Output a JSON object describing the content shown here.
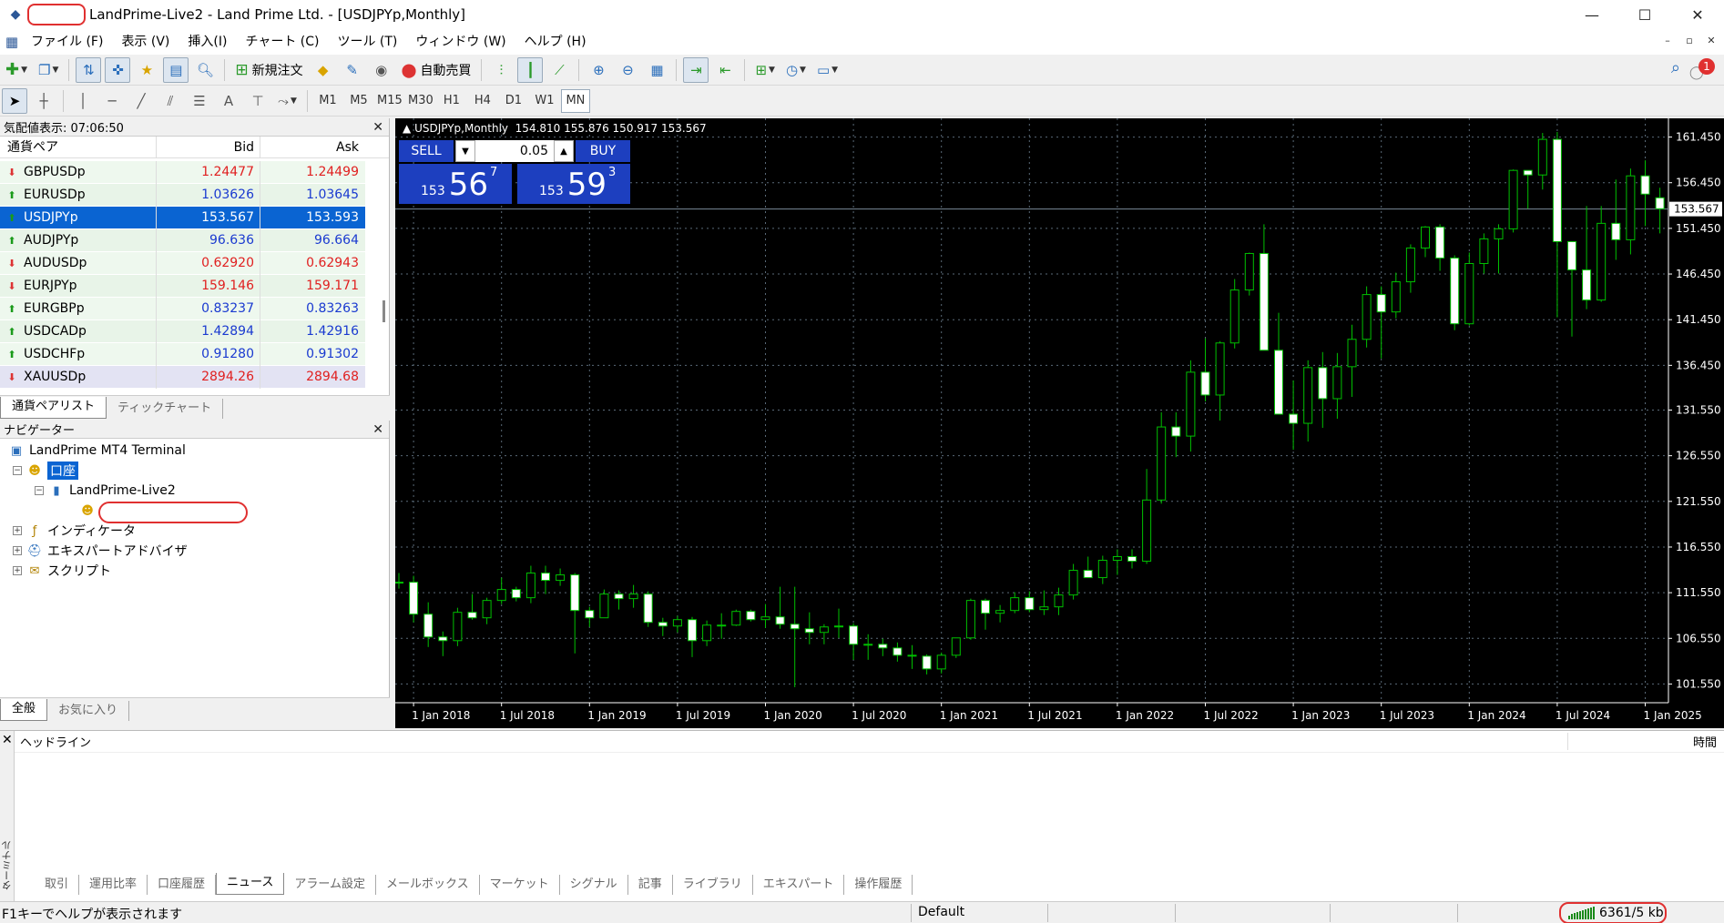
{
  "window": {
    "title": "LandPrime-Live2 - Land Prime Ltd. - [USDJPYp,Monthly]",
    "minimize": "—",
    "maximize": "☐",
    "close": "✕"
  },
  "menu": [
    "ファイル (F)",
    "表示 (V)",
    "挿入(I)",
    "チャート (C)",
    "ツール (T)",
    "ウィンドウ (W)",
    "ヘルプ (H)"
  ],
  "toolbar": {
    "new_order_label": "新規注文",
    "auto_trading_label": "自動売買",
    "notification_count": "1"
  },
  "timeframes": [
    "M1",
    "M5",
    "M15",
    "M30",
    "H1",
    "H4",
    "D1",
    "W1",
    "MN"
  ],
  "active_timeframe": "MN",
  "market_watch": {
    "title": "気配値表示: 07:06:50",
    "col_symbol": "通貨ペア",
    "col_bid": "Bid",
    "col_ask": "Ask",
    "rows": [
      {
        "symbol": "GBPUSDp",
        "bid": "1.24477",
        "ask": "1.24499",
        "dir": "down"
      },
      {
        "symbol": "EURUSDp",
        "bid": "1.03626",
        "ask": "1.03645",
        "dir": "up"
      },
      {
        "symbol": "USDJPYp",
        "bid": "153.567",
        "ask": "153.593",
        "dir": "up"
      },
      {
        "symbol": "AUDJPYp",
        "bid": "96.636",
        "ask": "96.664",
        "dir": "up"
      },
      {
        "symbol": "AUDUSDp",
        "bid": "0.62920",
        "ask": "0.62943",
        "dir": "down"
      },
      {
        "symbol": "EURJPYp",
        "bid": "159.146",
        "ask": "159.171",
        "dir": "down"
      },
      {
        "symbol": "EURGBPp",
        "bid": "0.83237",
        "ask": "0.83263",
        "dir": "up"
      },
      {
        "symbol": "USDCADp",
        "bid": "1.42894",
        "ask": "1.42916",
        "dir": "up"
      },
      {
        "symbol": "USDCHFp",
        "bid": "0.91280",
        "ask": "0.91302",
        "dir": "up"
      },
      {
        "symbol": "XAUUSDp",
        "bid": "2894.26",
        "ask": "2894.68",
        "dir": "down"
      }
    ],
    "tabs": [
      "通貨ペアリスト",
      "ティックチャート"
    ],
    "up_color": "#1a3ad0",
    "down_color": "#e02020"
  },
  "navigator": {
    "title": "ナビゲーター",
    "root": "LandPrime MT4 Terminal",
    "accounts": "口座",
    "server": "LandPrime-Live2",
    "indicators": "インディケータ",
    "experts": "エキスパートアドバイザ",
    "scripts": "スクリプト",
    "tabs": [
      "全般",
      "お気に入り"
    ]
  },
  "chart_data": {
    "type": "candlestick",
    "symbol_header": "USDJPYp,Monthly",
    "ohlc_header": "154.810 155.876 150.917 153.567",
    "current_price": "153.567",
    "current_price_value": 153.567,
    "ylim": [
      99.5,
      163.5
    ],
    "y_ticks": [
      "161.450",
      "156.450",
      "151.450",
      "146.450",
      "141.450",
      "136.450",
      "131.550",
      "126.550",
      "121.550",
      "116.550",
      "111.550",
      "106.550",
      "101.550"
    ],
    "y_tick_values": [
      161.45,
      156.45,
      151.45,
      146.45,
      141.45,
      136.45,
      131.55,
      126.55,
      121.55,
      116.55,
      111.55,
      106.55,
      101.55
    ],
    "x_ticks": [
      "1 Jan 2018",
      "1 Jul 2018",
      "1 Jan 2019",
      "1 Jul 2019",
      "1 Jan 2020",
      "1 Jul 2020",
      "1 Jan 2021",
      "1 Jul 2021",
      "1 Jan 2022",
      "1 Jul 2022",
      "1 Jan 2023",
      "1 Jul 2023",
      "1 Jan 2024",
      "1 Jul 2024",
      "1 Jan 2025"
    ],
    "start_month": "2017-12",
    "x_tick_indices": [
      1,
      7,
      13,
      19,
      25,
      31,
      37,
      43,
      49,
      55,
      61,
      67,
      73,
      79,
      85
    ],
    "candles": [
      [
        112.6,
        113.7,
        112.0,
        112.7
      ],
      [
        112.7,
        113.4,
        108.3,
        109.2
      ],
      [
        109.2,
        110.5,
        105.6,
        106.7
      ],
      [
        106.7,
        107.3,
        104.6,
        106.3
      ],
      [
        106.3,
        109.9,
        105.7,
        109.4
      ],
      [
        109.4,
        111.4,
        108.6,
        108.8
      ],
      [
        108.8,
        111.0,
        108.1,
        110.7
      ],
      [
        110.7,
        113.2,
        110.3,
        111.9
      ],
      [
        111.9,
        112.2,
        110.6,
        111.0
      ],
      [
        111.0,
        114.5,
        110.4,
        113.7
      ],
      [
        113.7,
        114.5,
        111.4,
        112.9
      ],
      [
        112.9,
        114.2,
        112.3,
        113.5
      ],
      [
        113.5,
        113.7,
        104.9,
        109.6
      ],
      [
        109.6,
        110.0,
        107.8,
        108.8
      ],
      [
        108.8,
        111.9,
        108.8,
        111.4
      ],
      [
        111.4,
        111.8,
        109.7,
        110.9
      ],
      [
        110.9,
        112.4,
        109.9,
        111.4
      ],
      [
        111.4,
        111.7,
        107.8,
        108.3
      ],
      [
        108.3,
        108.8,
        106.8,
        107.9
      ],
      [
        107.9,
        109.0,
        107.2,
        108.6
      ],
      [
        108.6,
        108.9,
        104.5,
        106.3
      ],
      [
        106.3,
        108.5,
        105.7,
        108.0
      ],
      [
        108.0,
        109.3,
        106.5,
        108.0
      ],
      [
        108.0,
        109.7,
        107.9,
        109.5
      ],
      [
        109.5,
        109.7,
        108.4,
        108.6
      ],
      [
        108.6,
        110.3,
        107.7,
        108.9
      ],
      [
        108.9,
        112.2,
        107.6,
        108.1
      ],
      [
        108.1,
        112.2,
        101.2,
        107.6
      ],
      [
        107.6,
        109.4,
        105.9,
        107.2
      ],
      [
        107.2,
        108.1,
        105.9,
        107.8
      ],
      [
        107.8,
        109.8,
        106.6,
        107.9
      ],
      [
        107.9,
        108.2,
        104.2,
        105.9
      ],
      [
        105.9,
        107.0,
        104.2,
        105.9
      ],
      [
        105.9,
        106.5,
        104.6,
        105.5
      ],
      [
        105.5,
        106.1,
        104.0,
        104.7
      ],
      [
        104.7,
        105.8,
        103.2,
        104.6
      ],
      [
        104.6,
        104.8,
        102.6,
        103.2
      ],
      [
        103.2,
        105.0,
        102.7,
        104.7
      ],
      [
        104.7,
        106.2,
        104.4,
        106.6
      ],
      [
        106.6,
        110.9,
        106.4,
        110.7
      ],
      [
        110.7,
        110.9,
        107.5,
        109.3
      ],
      [
        109.3,
        110.2,
        108.3,
        109.6
      ],
      [
        109.6,
        111.6,
        109.3,
        111.0
      ],
      [
        111.0,
        111.7,
        109.4,
        109.7
      ],
      [
        109.7,
        111.8,
        109.1,
        110.0
      ],
      [
        110.0,
        112.1,
        109.1,
        111.3
      ],
      [
        111.3,
        114.7,
        110.8,
        114.0
      ],
      [
        114.0,
        115.5,
        113.3,
        113.2
      ],
      [
        113.2,
        115.6,
        112.5,
        115.1
      ],
      [
        115.1,
        116.3,
        113.5,
        115.5
      ],
      [
        115.5,
        116.3,
        114.2,
        115.0
      ],
      [
        115.0,
        125.1,
        114.7,
        121.7
      ],
      [
        121.7,
        131.3,
        121.3,
        129.7
      ],
      [
        129.7,
        131.3,
        126.4,
        128.7
      ],
      [
        128.7,
        137.0,
        127.0,
        135.7
      ],
      [
        135.7,
        139.4,
        132.5,
        133.2
      ],
      [
        133.2,
        139.1,
        130.4,
        138.9
      ],
      [
        138.9,
        145.9,
        138.3,
        144.7
      ],
      [
        144.7,
        148.8,
        144.1,
        148.7
      ],
      [
        148.7,
        151.9,
        138.9,
        138.1
      ],
      [
        138.1,
        142.2,
        133.6,
        131.1
      ],
      [
        131.1,
        134.8,
        127.2,
        130.1
      ],
      [
        130.1,
        137.0,
        128.1,
        136.2
      ],
      [
        136.2,
        137.9,
        129.6,
        132.8
      ],
      [
        132.8,
        137.8,
        130.6,
        136.3
      ],
      [
        136.3,
        140.9,
        133.0,
        139.3
      ],
      [
        139.3,
        145.1,
        138.4,
        144.2
      ],
      [
        144.2,
        145.1,
        137.2,
        142.3
      ],
      [
        142.3,
        146.6,
        141.6,
        145.6
      ],
      [
        145.6,
        149.7,
        144.4,
        149.3
      ],
      [
        149.3,
        151.7,
        148.3,
        151.6
      ],
      [
        151.6,
        151.9,
        146.8,
        148.2
      ],
      [
        148.2,
        148.5,
        140.3,
        141.0
      ],
      [
        141.0,
        148.8,
        140.8,
        147.6
      ],
      [
        147.6,
        150.9,
        146.5,
        150.3
      ],
      [
        150.3,
        151.9,
        146.5,
        151.4
      ],
      [
        151.4,
        157.9,
        151.0,
        157.8
      ],
      [
        157.8,
        157.7,
        153.6,
        157.3
      ],
      [
        157.3,
        161.9,
        155.7,
        161.2
      ],
      [
        161.2,
        162.0,
        141.7,
        150.0
      ],
      [
        150.0,
        147.9,
        139.6,
        146.9
      ],
      [
        146.9,
        153.9,
        142.6,
        143.6
      ],
      [
        143.6,
        153.9,
        143.4,
        152.0
      ],
      [
        152.0,
        156.8,
        148.0,
        150.2
      ],
      [
        150.2,
        158.0,
        148.6,
        157.2
      ],
      [
        157.2,
        158.9,
        151.7,
        155.2
      ],
      [
        154.8,
        155.9,
        150.9,
        153.6
      ]
    ]
  },
  "trade": {
    "sell_label": "SELL",
    "buy_label": "BUY",
    "lot": "0.05",
    "sell_big_prefix": "153",
    "sell_big": "56",
    "sell_sup": "7",
    "buy_big_prefix": "153",
    "buy_big": "59",
    "buy_sup": "3"
  },
  "terminal": {
    "vertical_label": "ターミナル",
    "col_headline": "ヘッドライン",
    "col_time": "時間",
    "tabs": [
      "取引",
      "運用比率",
      "口座履歴",
      "ニュース",
      "アラーム設定",
      "メールボックス",
      "マーケット",
      "シグナル",
      "記事",
      "ライブラリ",
      "エキスパート",
      "操作履歴"
    ],
    "active_tab": "ニュース"
  },
  "status": {
    "help": "F1キーでヘルプが表示されます",
    "profile": "Default",
    "connection": "6361/5 kb"
  },
  "colors": {
    "chart_bg": "#000000",
    "candle_bull_fill": "#000000",
    "candle_bear_fill": "#ffffff",
    "candle_outline": "#00c000",
    "grid": "#5a6a78",
    "accent": "#0a64d2",
    "trade_panel": "#1d3fbf",
    "annotation": "#e03030"
  }
}
